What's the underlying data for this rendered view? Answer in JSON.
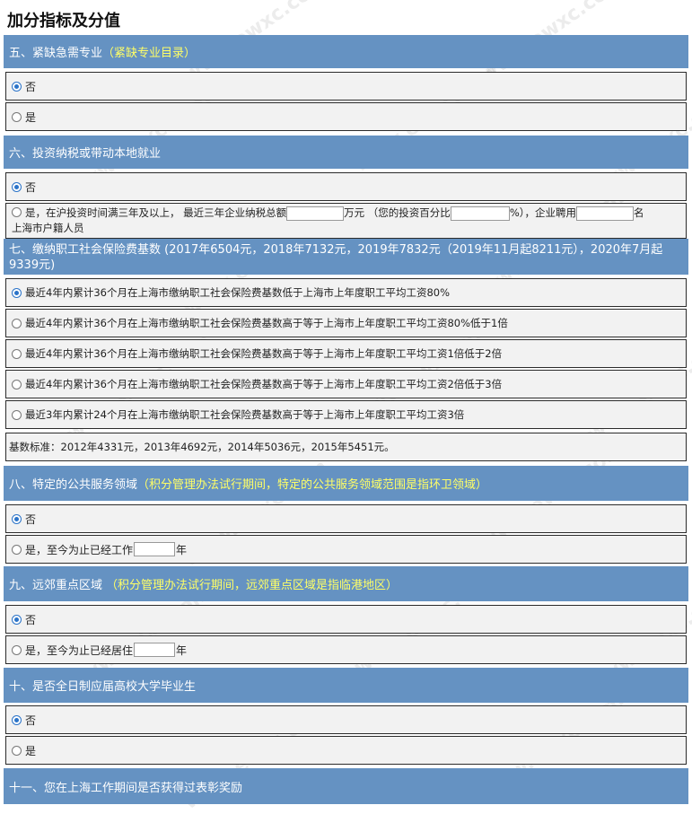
{
  "page": {
    "title": "加分指标及分值",
    "watermark": "www.ewxc.com"
  },
  "sec5": {
    "title": "五、紧缺急需专业",
    "highlight": "（紧缺专业目录）",
    "options": [
      "否",
      "是"
    ]
  },
  "sec6": {
    "title": "六、投资纳税或带动本地就业",
    "opt_no": "否",
    "opt_yes": {
      "a": "是，在沪投资时间满三年及以上， 最近三年企业纳税总额",
      "b": "万元 （您的投资百分比",
      "c": "%），企业聘用",
      "d": "名",
      "e": "上海市户籍人员"
    }
  },
  "sec7": {
    "title": "七、缴纳职工社会保险费基数 (2017年6504元，2018年7132元，2019年7832元（2019年11月起8211元），2020年7月起9339元)",
    "options": [
      "最近4年内累计36个月在上海市缴纳职工社会保险费基数低于上海市上年度职工平均工资80%",
      "最近4年内累计36个月在上海市缴纳职工社会保险费基数高于等于上海市上年度职工平均工资80%低于1倍",
      "最近4年内累计36个月在上海市缴纳职工社会保险费基数高于等于上海市上年度职工平均工资1倍低于2倍",
      "最近4年内累计36个月在上海市缴纳职工社会保险费基数高于等于上海市上年度职工平均工资2倍低于3倍",
      "最近3年内累计24个月在上海市缴纳职工社会保险费基数高于等于上海市上年度职工平均工资3倍"
    ],
    "note": "基数标准：2012年4331元，2013年4692元，2014年5036元，2015年5451元。"
  },
  "sec8": {
    "title": "八、特定的公共服务领域",
    "highlight": "（积分管理办法试行期间，特定的公共服务领域范围是指环卫领域）",
    "opt_no": "否",
    "opt_yes_a": "是，至今为止已经工作",
    "opt_yes_b": "年"
  },
  "sec9": {
    "title": "九、远郊重点区域",
    "highlight": "（积分管理办法试行期间，远郊重点区域是指临港地区）",
    "opt_no": "否",
    "opt_yes_a": "是，至今为止已经居住",
    "opt_yes_b": "年"
  },
  "sec10": {
    "title": "十、是否全日制应届高校大学毕业生",
    "options": [
      "否",
      "是"
    ]
  },
  "sec11": {
    "title": "十一、您在上海工作期间是否获得过表彰奖励"
  },
  "colors": {
    "header_bg": "#6592c2",
    "highlight": "#ffff66",
    "radio_checked": "#2a73c8"
  }
}
